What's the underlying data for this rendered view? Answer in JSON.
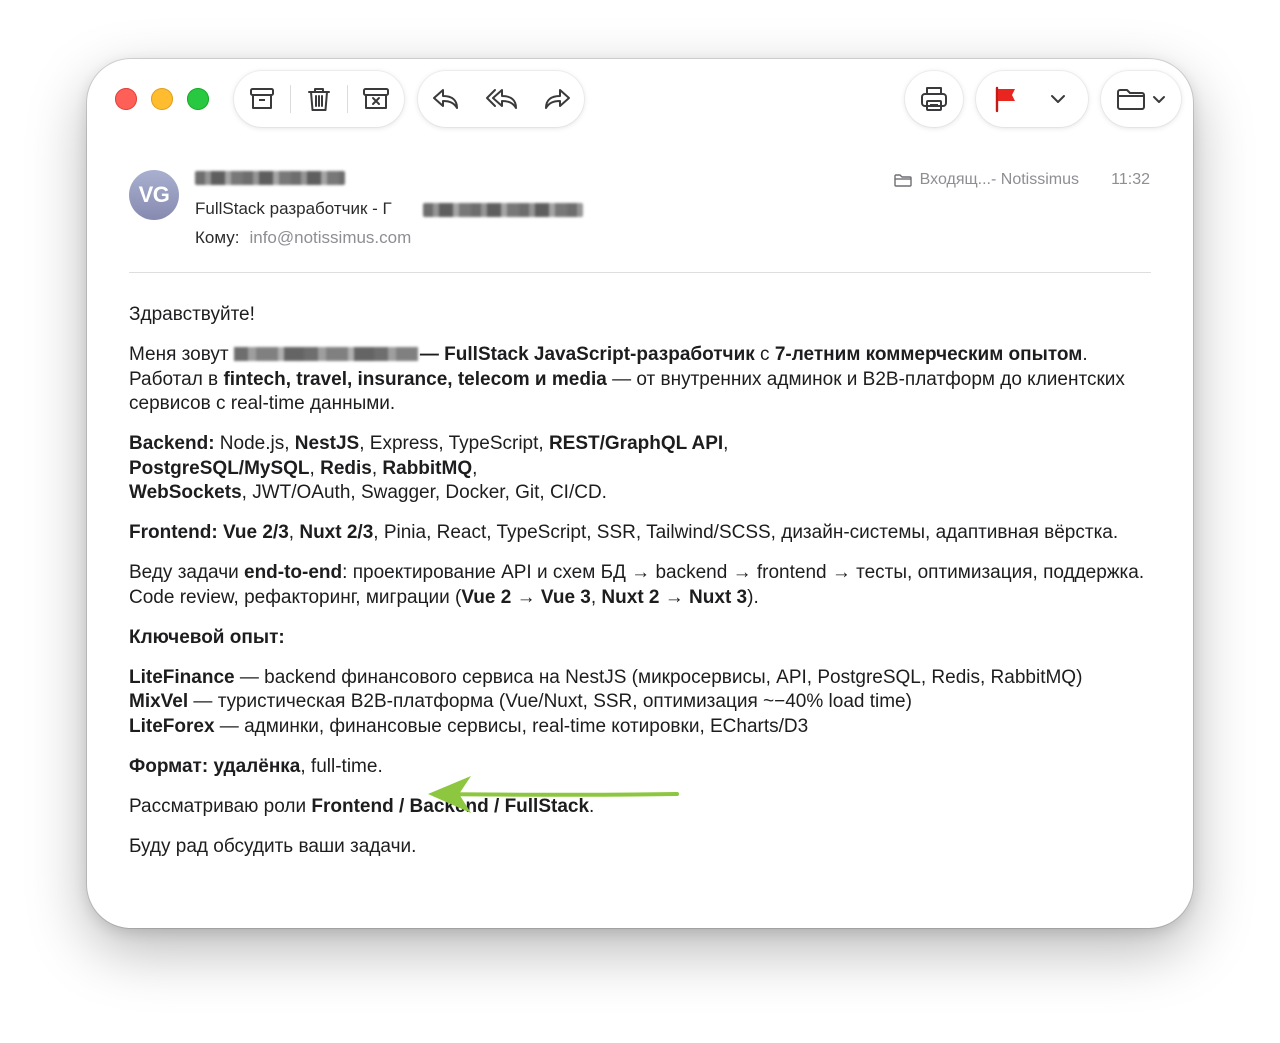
{
  "toolbar": {
    "archive": "archive-icon",
    "trash": "trash-icon",
    "junk": "junk-icon",
    "reply": "reply-icon",
    "reply_all": "reply-all-icon",
    "forward": "forward-icon",
    "print": "print-icon",
    "flag": "flag-icon",
    "flag_color": "#e8251f",
    "move": "folder-icon"
  },
  "message": {
    "avatar_initials": "VG",
    "subject": "FullStack разработчик - Г",
    "to_label": "Кому:",
    "to_value": "info@notissimus.com",
    "folder": "Входящ...- Notissimus",
    "time": "11:32"
  },
  "body": {
    "greeting": "Здравствуйте!",
    "intro": {
      "a": "Меня зовут ",
      "b": "— FullStack JavaScript-разработчик",
      "c": " с ",
      "d": "7-летним коммерческим опытом",
      "e": ". Работал в ",
      "f": "fintech, travel, insurance, telecom и media",
      "g": " — от внутренних админок и B2B-платформ до клиентских сервисов с real-time данными."
    },
    "backend": {
      "label": "Backend:",
      "t1": " Node.js, ",
      "nest": "NestJS",
      "t2": ", Express, TypeScript, ",
      "api": "REST/GraphQL API",
      "t3": ", ",
      "db": "PostgreSQL/MySQL",
      "t4": ", ",
      "redis": "Redis",
      "t5": ", ",
      "rabbit": "RabbitMQ",
      "t6": ", ",
      "ws": "WebSockets",
      "t7": ", JWT/OAuth, Swagger, Docker, Git, CI/CD."
    },
    "frontend": {
      "label": "Frontend:",
      "t1": " ",
      "vue": "Vue 2/3",
      "t2": ", ",
      "nuxt": "Nuxt 2/3",
      "t3": ", Pinia, React, TypeScript, SSR, Tailwind/SCSS, дизайн-системы, адаптивная вёрстка."
    },
    "tasks": {
      "t1": "Веду задачи ",
      "e2e": "end-to-end",
      "t2": ": проектирование API и схем БД → backend → frontend → тесты, оптимизация, поддержка. Code review, рефакторинг, миграции (",
      "vue": "Vue 2 → Vue 3",
      "t3": ", ",
      "nuxt": "Nuxt 2 → Nuxt 3",
      "t4": ")."
    },
    "key_heading": "Ключевой опыт:",
    "exp": [
      {
        "name": "LiteFinance",
        "text": " — backend финансового сервиса на NestJS (микросервисы, API, PostgreSQL, Redis, RabbitMQ)"
      },
      {
        "name": "MixVel",
        "text": " — туристическая B2B-платформа (Vue/Nuxt, SSR, оптимизация ~−40% load time)"
      },
      {
        "name": "LiteForex",
        "text": " — админки, финансовые сервисы, real-time котировки, ECharts/D3"
      }
    ],
    "format": {
      "label": "Формат: удалёнка",
      "rest": ", full-time."
    },
    "roles": {
      "t1": "Рассматриваю роли ",
      "roles": "Frontend / Backend / FullStack",
      "t2": "."
    },
    "closing": "Буду рад обсудить ваши задачи."
  },
  "annotation_color": "#8dc63f"
}
